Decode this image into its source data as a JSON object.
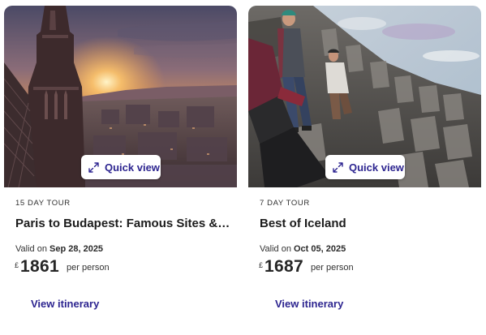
{
  "cards": [
    {
      "image_alt": "Gothic cathedral spire over a city at sunset",
      "quick_view_label": "Quick view",
      "duration": "15 DAY TOUR",
      "name": "Paris to Budapest: Famous Sites & T...",
      "valid_prefix": "Valid on",
      "valid_date": "Sep 28, 2025",
      "currency": "£",
      "price": "1861",
      "per_person": "per person",
      "itinerary_label": "View itinerary"
    },
    {
      "image_alt": "Hikers on basalt columns in Iceland",
      "quick_view_label": "Quick view",
      "duration": "7 DAY TOUR",
      "name": "Best of Iceland",
      "valid_prefix": "Valid on",
      "valid_date": "Oct 05, 2025",
      "currency": "£",
      "price": "1687",
      "per_person": "per person",
      "itinerary_label": "View itinerary"
    }
  ],
  "colors": {
    "accent": "#2d2590",
    "text": "#1c1c1c"
  },
  "icons": {
    "quick_view": "expand-arrows-icon"
  }
}
